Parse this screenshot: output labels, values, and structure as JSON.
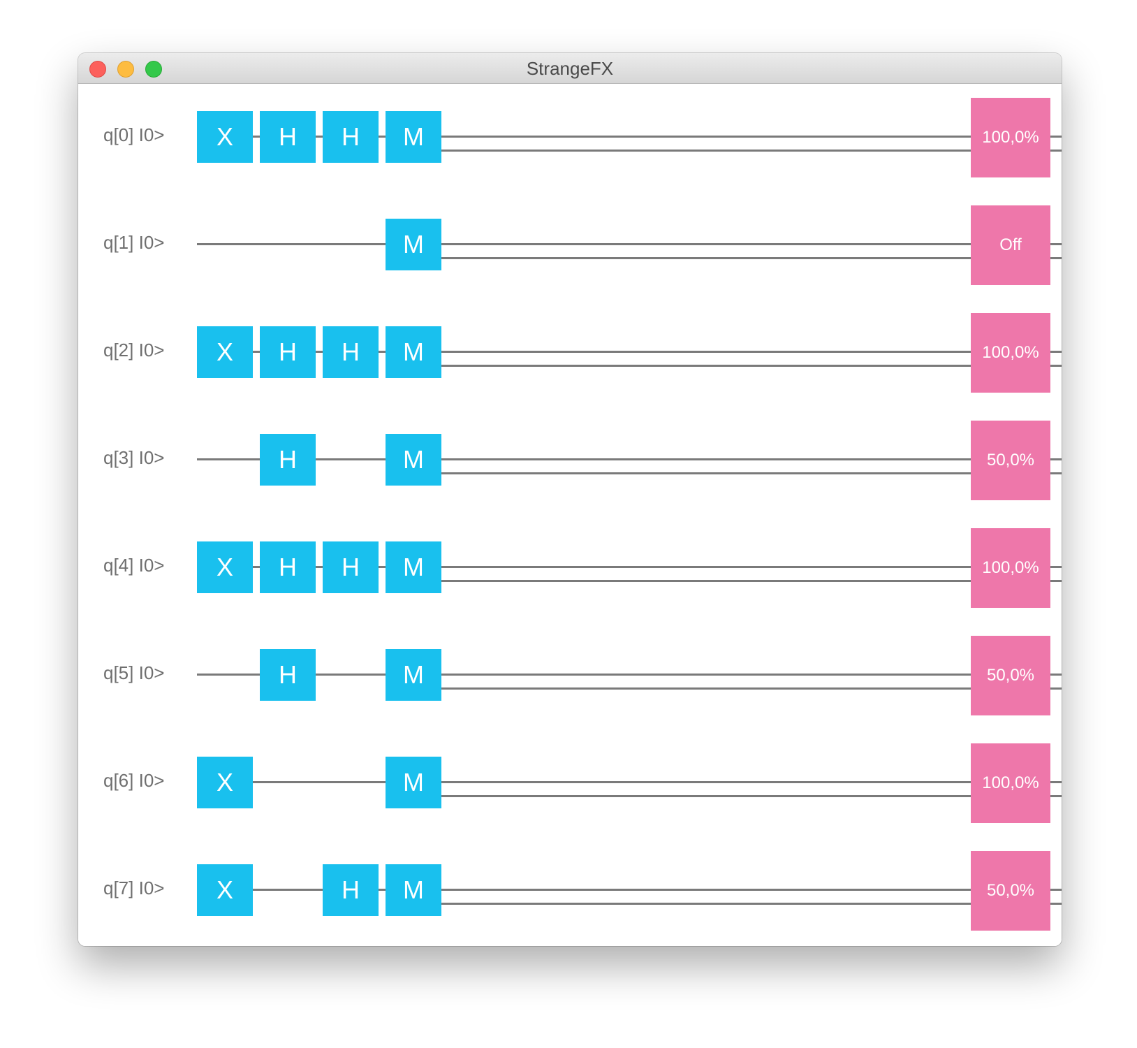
{
  "window": {
    "title": "StrangeFX"
  },
  "colors": {
    "gate": "#19c0ee",
    "result": "#ee77aa",
    "wire": "#7a7a7a",
    "label": "#6f6f6f"
  },
  "qubits": [
    {
      "label": "q[0] I0>",
      "gates": [
        "X",
        "H",
        "H",
        "M"
      ],
      "result": "100,0%"
    },
    {
      "label": "q[1] I0>",
      "gates": [
        "",
        "",
        "",
        "M"
      ],
      "result": "Off"
    },
    {
      "label": "q[2] I0>",
      "gates": [
        "X",
        "H",
        "H",
        "M"
      ],
      "result": "100,0%"
    },
    {
      "label": "q[3] I0>",
      "gates": [
        "",
        "H",
        "",
        "M"
      ],
      "result": "50,0%"
    },
    {
      "label": "q[4] I0>",
      "gates": [
        "X",
        "H",
        "H",
        "M"
      ],
      "result": "100,0%"
    },
    {
      "label": "q[5] I0>",
      "gates": [
        "",
        "H",
        "",
        "M"
      ],
      "result": "50,0%"
    },
    {
      "label": "q[6] I0>",
      "gates": [
        "X",
        "",
        "",
        "M"
      ],
      "result": "100,0%"
    },
    {
      "label": "q[7] I0>",
      "gates": [
        "X",
        "",
        "H",
        "M"
      ],
      "result": "50,0%"
    }
  ]
}
